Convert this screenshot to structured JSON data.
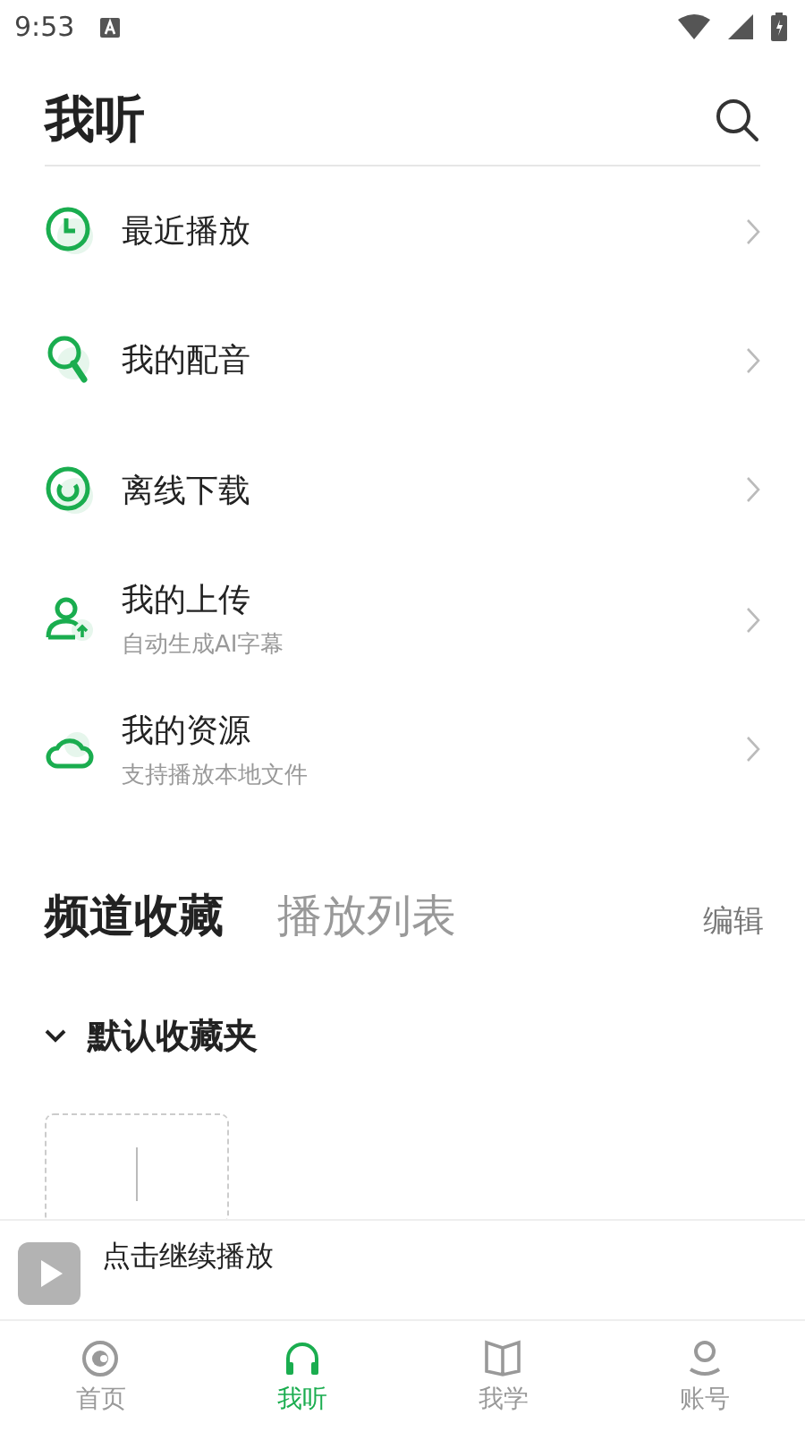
{
  "status_bar": {
    "time": "9:53"
  },
  "header": {
    "title": "我听"
  },
  "menu": [
    {
      "label": "最近播放"
    },
    {
      "label": "我的配音"
    },
    {
      "label": "离线下载"
    },
    {
      "label": "我的上传",
      "subtitle": "自动生成AI字幕"
    },
    {
      "label": "我的资源",
      "subtitle": "支持播放本地文件"
    }
  ],
  "tabs": [
    {
      "label": "频道收藏",
      "selected": true
    },
    {
      "label": "播放列表",
      "selected": false
    }
  ],
  "edit_label": "编辑",
  "folder": {
    "title": "默认收藏夹",
    "expanded": true
  },
  "player": {
    "label": "点击继续播放"
  },
  "bottom_nav": [
    {
      "label": "首页",
      "selected": false
    },
    {
      "label": "我听",
      "selected": true
    },
    {
      "label": "我学",
      "selected": false
    },
    {
      "label": "账号",
      "selected": false
    }
  ]
}
